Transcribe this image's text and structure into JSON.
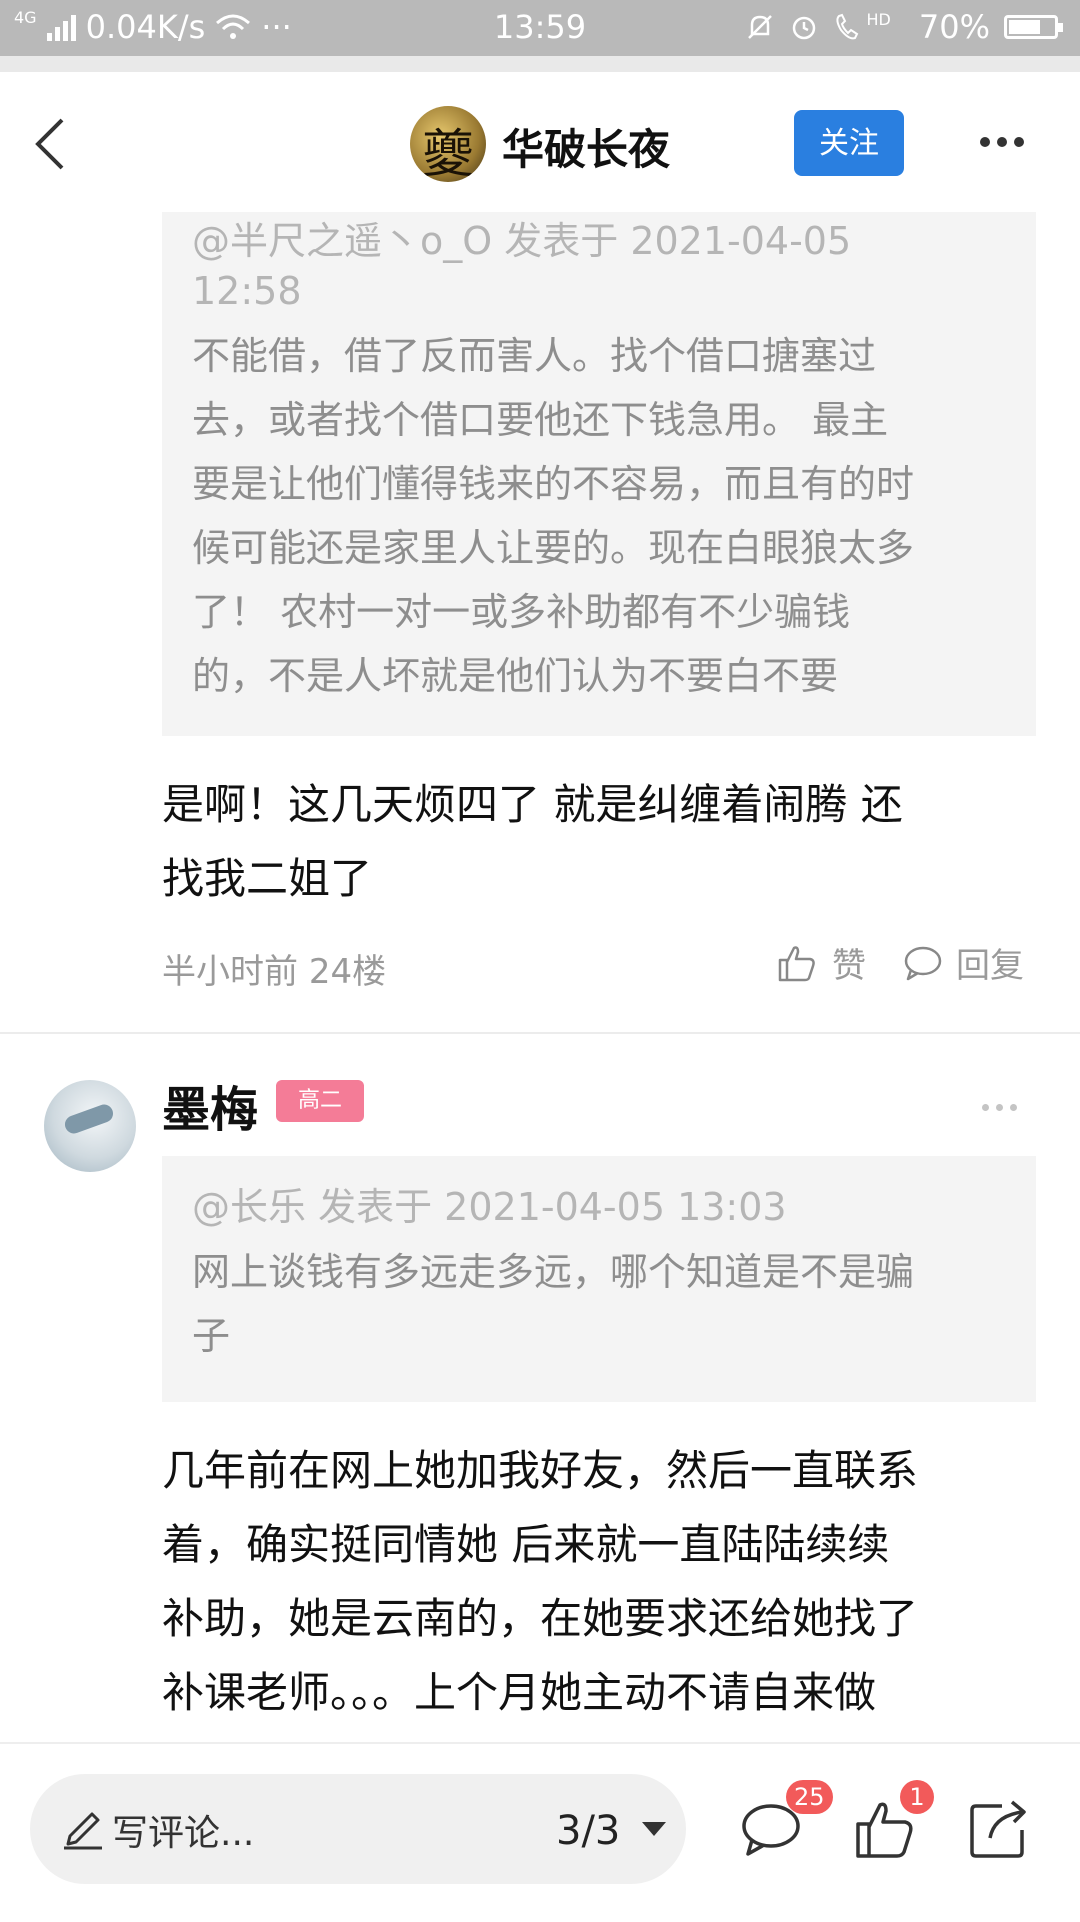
{
  "status_bar": {
    "network": "4G",
    "speed": "0.04K/s",
    "dots": "···",
    "time": "13:59",
    "hd": "HD",
    "battery": "70%",
    "battery_level": 0.7
  },
  "header": {
    "title": "华破长夜",
    "follow_label": "关注"
  },
  "posts": [
    {
      "quote_meta": "@半尺之遥丶o_O 发表于 2021-04-05 12:58",
      "quote_lines": [
        "不能借，借了反而害人。找个借口搪塞过",
        "去，或者找个借口要他还下钱急用。 最主",
        "要是让他们懂得钱来的不容易，而且有的时",
        "候可能还是家里人让要的。现在白眼狼太多",
        "了！ 农村一对一或多补助都有不少骗钱",
        "的，不是人坏就是他们认为不要白不要"
      ],
      "text_lines": [
        "是啊！这几天烦四了 就是纠缠着闹腾 还",
        "找我二姐了"
      ],
      "time": "半小时前",
      "floor": "24楼",
      "like_label": "赞",
      "reply_label": "回复"
    },
    {
      "user": "墨梅",
      "badge": "高二",
      "quote_meta": "@长乐 发表于 2021-04-05 13:03",
      "quote_lines": [
        "网上谈钱有多远走多远，哪个知道是不是骗",
        "子"
      ],
      "text_lines": [
        "几年前在网上她加我好友，然后一直联系",
        "着，确实挺同情她 后来就一直陆陆续续",
        "补助，她是云南的，在她要求还给她找了",
        "补课老师。。。上个月她主动不请自来做"
      ]
    }
  ],
  "bottom_bar": {
    "comment_placeholder": "写评论...",
    "page_indicator": "3/3",
    "comment_count": "25",
    "like_count": "1"
  },
  "icons": {
    "back": "back-arrow-icon",
    "more": "more-icon",
    "like": "thumb-up-icon",
    "reply": "comment-bubble-icon",
    "pen": "pen-icon",
    "share": "share-icon"
  }
}
